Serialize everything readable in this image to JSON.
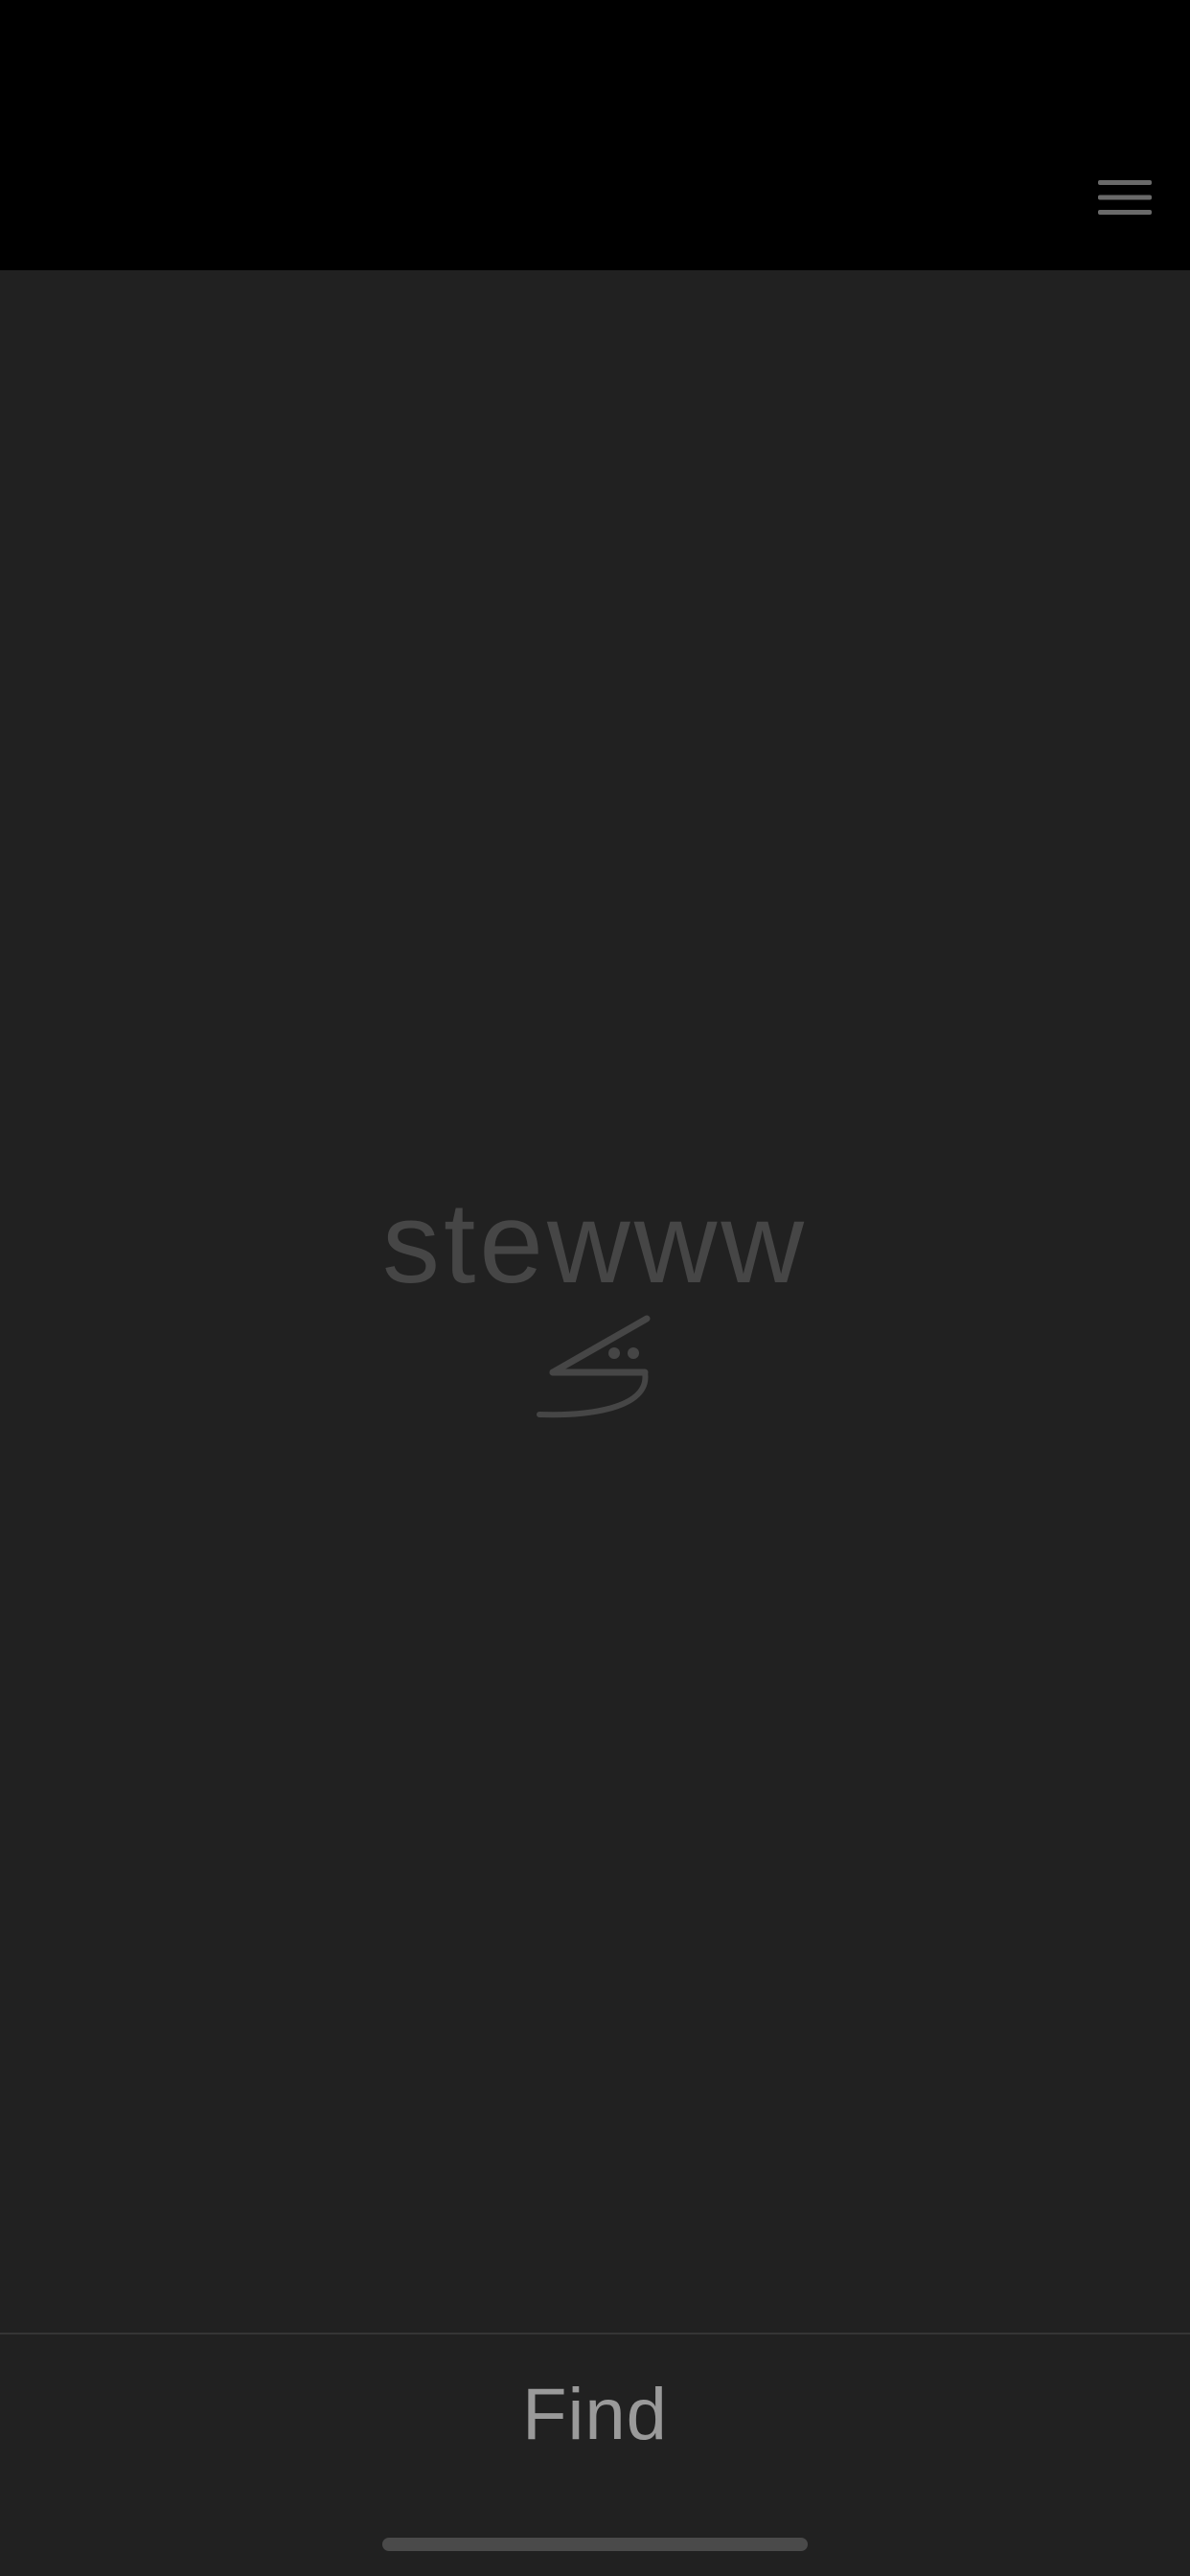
{
  "header": {
    "menu_icon": "hamburger-menu-icon"
  },
  "main": {
    "brand_name": "stewww",
    "brand_mark_icon": "stewww-logo-mark"
  },
  "footer": {
    "find_label": "Find"
  },
  "colors": {
    "top_bar": "#000000",
    "background": "#212121",
    "brand_text": "#464646",
    "find_text": "#9a9a9a",
    "menu_icon": "#6a6a6a",
    "home_indicator": "#4a4a4a"
  }
}
